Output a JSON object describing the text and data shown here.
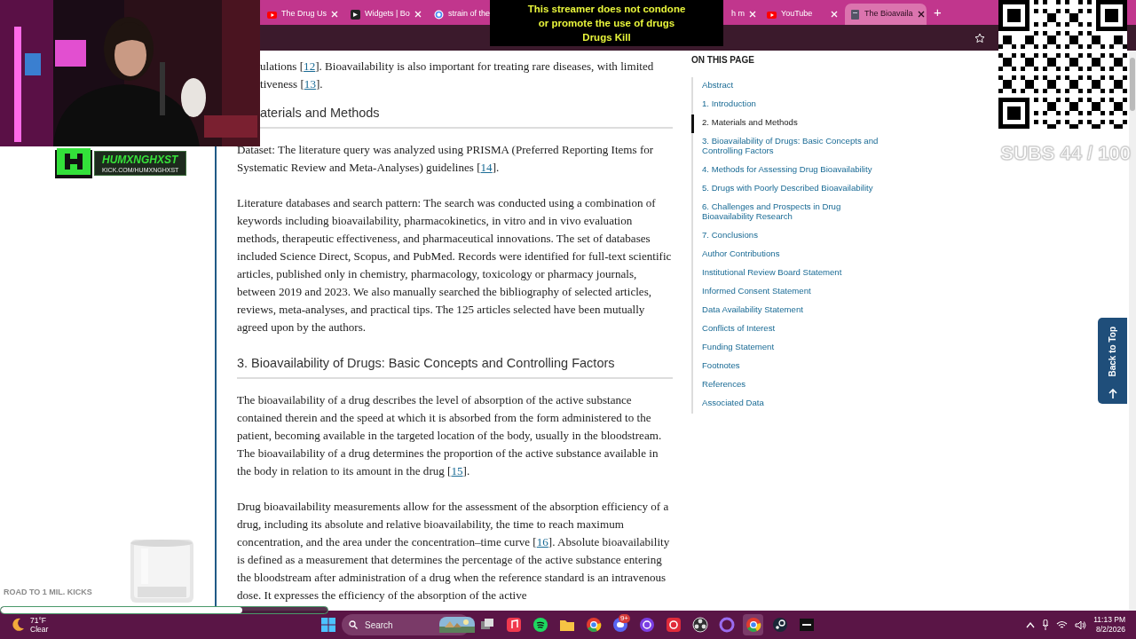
{
  "browser": {
    "tabs": [
      {
        "label": "The Drug Us",
        "kind": "youtube",
        "selected": false,
        "close_button": true
      },
      {
        "label": "Widgets | Bo",
        "kind": "widget",
        "selected": false,
        "close_button": true
      },
      {
        "label": "strain of the",
        "kind": "google",
        "selected": false,
        "close_button": false
      },
      {
        "label": "h m",
        "kind": "partial",
        "selected": false,
        "close_button": true
      },
      {
        "label": "YouTube",
        "kind": "youtube",
        "selected": false,
        "close_button": true
      },
      {
        "label": "The Bioavaila",
        "kind": "doc",
        "selected": true,
        "close_button": true
      }
    ],
    "new_tab": "+"
  },
  "article": {
    "cut_lines": [
      [
        {
          "kind": "text",
          "text": "ulations ["
        },
        {
          "kind": "ref",
          "text": "12"
        },
        {
          "kind": "text",
          "text": "]. Bioavailability is also important for treating rare diseases, with limited"
        }
      ],
      [
        {
          "kind": "text",
          "text": "tiveness ["
        },
        {
          "kind": "ref",
          "text": "13"
        },
        {
          "kind": "text",
          "text": "]."
        }
      ]
    ],
    "cut_heading": "aterials and Methods",
    "blocks": [
      {
        "kind": "paragraph",
        "parts": [
          {
            "kind": "text",
            "text": "Dataset: The literature query was analyzed using PRISMA (Preferred Reporting Items for Systematic Review and Meta-Analyses) guidelines ["
          },
          {
            "kind": "ref",
            "text": "14"
          },
          {
            "kind": "text",
            "text": "]."
          }
        ]
      },
      {
        "kind": "paragraph",
        "parts": [
          {
            "kind": "text",
            "text": "Literature databases and search pattern: The search was conducted using a combination of keywords including bioavailability, pharmacokinetics, in vitro and in vivo evaluation methods, therapeutic effectiveness, and pharmaceutical innovations. The set of databases included Science Direct, Scopus, and PubMed. Records were identified for full-text scientific articles, published only in chemistry, pharmacology, toxicology or pharmacy journals, between 2019 and 2023. We also manually searched the bibliography of selected articles, reviews, meta-analyses, and practical tips. The 125 articles selected have been mutually agreed upon by the authors."
          }
        ]
      },
      {
        "kind": "heading",
        "text": "3. Bioavailability of Drugs: Basic Concepts and Controlling Factors"
      },
      {
        "kind": "paragraph",
        "parts": [
          {
            "kind": "text",
            "text": "The bioavailability of a drug describes the level of absorption of the active substance contained therein and the speed at which it is absorbed from the form administered to the patient, becoming available in the targeted location of the body, usually in the bloodstream. The bioavailability of a drug determines the proportion of the active substance available in the body in relation to its amount in the drug ["
          },
          {
            "kind": "ref",
            "text": "15"
          },
          {
            "kind": "text",
            "text": "]."
          }
        ]
      },
      {
        "kind": "paragraph",
        "parts": [
          {
            "kind": "text",
            "text": "Drug bioavailability measurements allow for the assessment of the absorption efficiency of a drug, including its absolute and relative bioavailability, the time to reach maximum concentration, and the area under the concentration–time curve ["
          },
          {
            "kind": "ref",
            "text": "16"
          },
          {
            "kind": "text",
            "text": "]. Absolute bioavailability is defined as a measurement that determines the percentage of the active substance entering the bloodstream after administration of a drug when the reference standard is an intravenous dose. It expresses the efficiency of the absorption of the active"
          }
        ]
      }
    ]
  },
  "toc": {
    "title": "ON THIS PAGE",
    "items": [
      {
        "label": "Abstract",
        "selected": false
      },
      {
        "label": "1. Introduction",
        "selected": false
      },
      {
        "label": "2. Materials and Methods",
        "selected": true
      },
      {
        "label": "3. Bioavailability of Drugs: Basic Concepts and Controlling Factors",
        "selected": false
      },
      {
        "label": "4. Methods for Assessing Drug Bioavailability",
        "selected": false
      },
      {
        "label": "5. Drugs with Poorly Described Bioavailability",
        "selected": false
      },
      {
        "label": "6. Challenges and Prospects in Drug Bioavailability Research",
        "selected": false
      },
      {
        "label": "7. Conclusions",
        "selected": false
      },
      {
        "label": "Author Contributions",
        "selected": false
      },
      {
        "label": "Institutional Review Board Statement",
        "selected": false
      },
      {
        "label": "Informed Consent Statement",
        "selected": false
      },
      {
        "label": "Data Availability Statement",
        "selected": false
      },
      {
        "label": "Conflicts of Interest",
        "selected": false
      },
      {
        "label": "Funding Statement",
        "selected": false
      },
      {
        "label": "Footnotes",
        "selected": false
      },
      {
        "label": "References",
        "selected": false
      },
      {
        "label": "Associated Data",
        "selected": false
      }
    ]
  },
  "back_to_top": "Back to Top",
  "overlay": {
    "banner": [
      "This streamer does not condone",
      "or promote the use of drugs",
      "Drugs Kill"
    ],
    "channel_name": "HUMXNGHXST",
    "channel_url": "KICK.COM/HUMXNGHXST",
    "subs": "SUBS 44 / 100",
    "goal_label": "ROAD TO 1 MIL. KICKS",
    "goal_bar": {
      "level": 0.74
    }
  },
  "taskbar": {
    "weather": {
      "temp": "71°F",
      "condition": "Clear"
    },
    "search": {
      "placeholder": "Search"
    },
    "apps": [
      {
        "kind": "taskview",
        "selected": false
      },
      {
        "kind": "music",
        "selected": false
      },
      {
        "kind": "spotify",
        "selected": false
      },
      {
        "kind": "folder",
        "selected": false
      },
      {
        "kind": "chrome",
        "selected": false
      },
      {
        "kind": "discord",
        "selected": false,
        "badge": "9+"
      },
      {
        "kind": "browser",
        "selected": false
      },
      {
        "kind": "record",
        "selected": false
      },
      {
        "kind": "obs",
        "selected": false
      },
      {
        "kind": "ring",
        "selected": false
      },
      {
        "kind": "chrome",
        "selected": true
      },
      {
        "kind": "steam",
        "selected": false
      },
      {
        "kind": "square",
        "selected": false
      }
    ],
    "time": "11:13 PM",
    "date": "8/2/2026"
  }
}
